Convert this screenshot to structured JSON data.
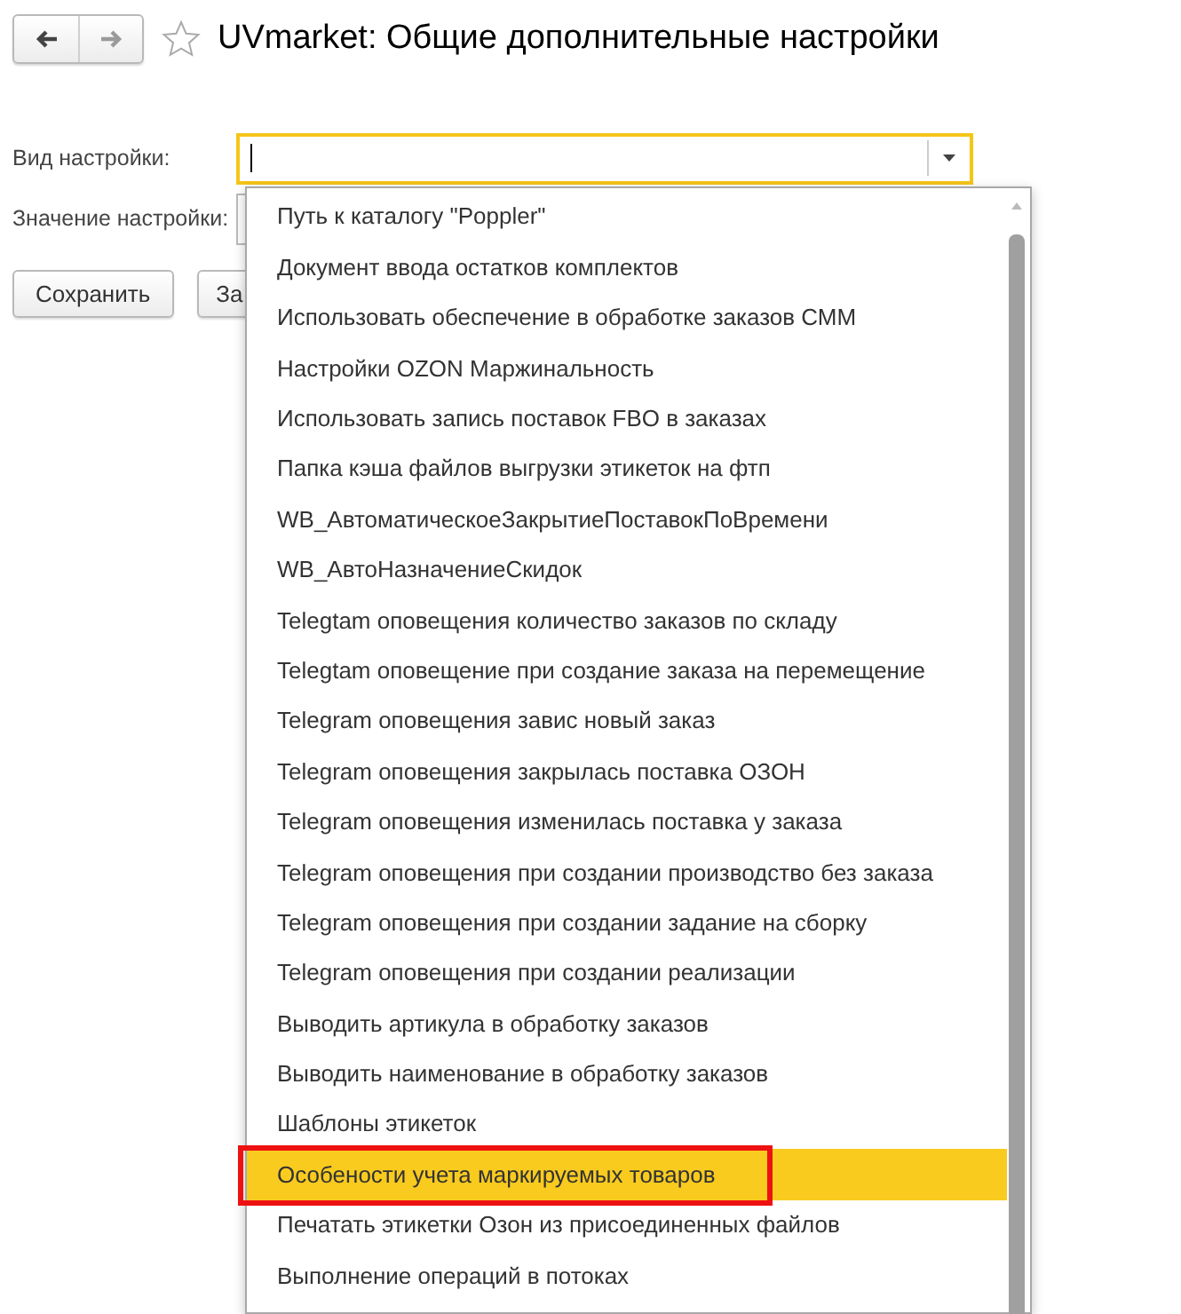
{
  "window": {
    "title": "UVmarket: Общие дополнительные настройки"
  },
  "navigation": {
    "back_enabled": true,
    "forward_enabled": false,
    "favorite": false
  },
  "form": {
    "fields": [
      {
        "label": "Вид настройки:",
        "focused": true
      },
      {
        "label": "Значение настройки:",
        "focused": false
      }
    ],
    "buttons": [
      "Сохранить",
      "За"
    ]
  },
  "dropdown": {
    "items": [
      {
        "label": "Путь к каталогу \"Poppler\"",
        "selected": false,
        "outlined": false
      },
      {
        "label": "Документ ввода остатков комплектов",
        "selected": false,
        "outlined": false
      },
      {
        "label": "Использовать обеспечение в обработке заказов СММ",
        "selected": false,
        "outlined": false
      },
      {
        "label": "Настройки OZON Маржинальность",
        "selected": false,
        "outlined": false
      },
      {
        "label": "Использовать запись поставок FBO в заказах",
        "selected": false,
        "outlined": false
      },
      {
        "label": "Папка кэша файлов выгрузки этикеток на фтп",
        "selected": false,
        "outlined": false
      },
      {
        "label": "WB_АвтоматическоеЗакрытиеПоставокПоВремени",
        "selected": false,
        "outlined": false
      },
      {
        "label": "WB_АвтоНазначениеСкидок",
        "selected": false,
        "outlined": false
      },
      {
        "label": "Telegtam оповещения количество заказов по складу",
        "selected": false,
        "outlined": false
      },
      {
        "label": "Telegtam оповещение при создание заказа на перемещение",
        "selected": false,
        "outlined": false
      },
      {
        "label": "Telegram оповещения завис новый заказ",
        "selected": false,
        "outlined": false
      },
      {
        "label": "Telegram оповещения закрылась поставка ОЗОН",
        "selected": false,
        "outlined": false
      },
      {
        "label": "Telegram оповещения изменилась поставка у заказа",
        "selected": false,
        "outlined": false
      },
      {
        "label": "Telegram оповещения при создании производство без заказа",
        "selected": false,
        "outlined": false
      },
      {
        "label": "Telegram оповещения при создании задание на сборку",
        "selected": false,
        "outlined": false
      },
      {
        "label": "Telegram оповещения при создании реализации",
        "selected": false,
        "outlined": false
      },
      {
        "label": "Выводить артикула в обработку заказов",
        "selected": false,
        "outlined": false
      },
      {
        "label": "Выводить наименование в обработку заказов",
        "selected": false,
        "outlined": false
      },
      {
        "label": "Шаблоны этикеток",
        "selected": false,
        "outlined": false
      },
      {
        "label": "Особености учета маркируемых товаров",
        "selected": true,
        "outlined": true
      },
      {
        "label": "Печатать этикетки Озон из присоединенных файлов",
        "selected": false,
        "outlined": false
      },
      {
        "label": "Выполнение операций в потоках",
        "selected": false,
        "outlined": false
      }
    ]
  }
}
